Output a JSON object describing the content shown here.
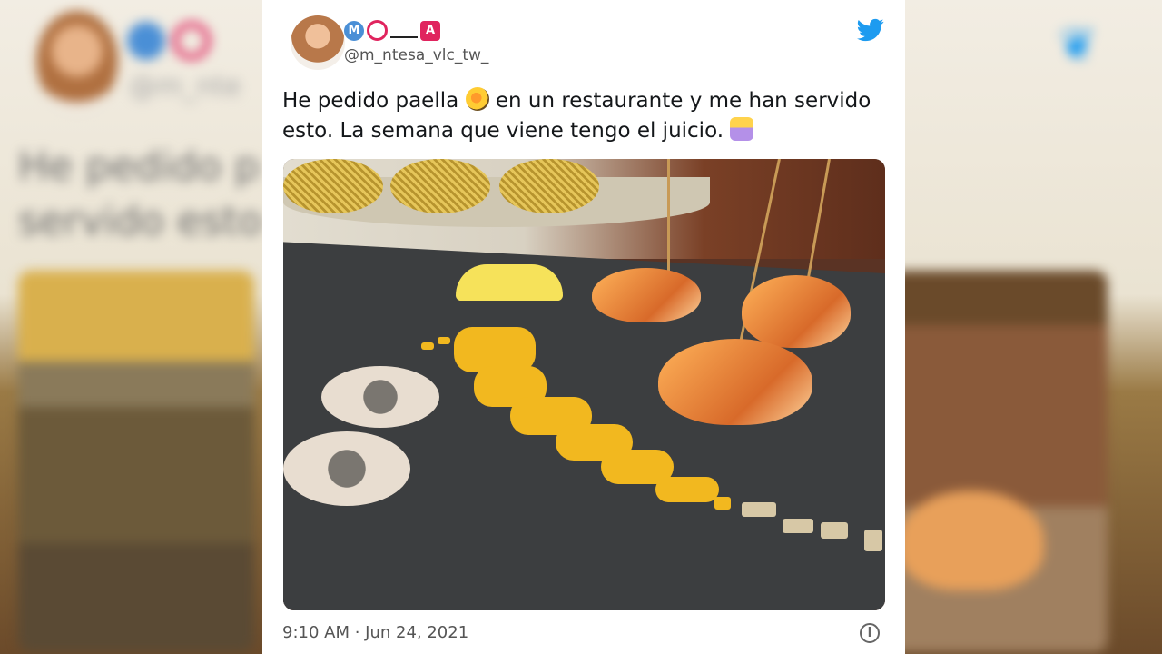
{
  "tweet": {
    "display_name_badges": [
      "M",
      "O",
      "A"
    ],
    "handle": "@m_ntesa_vlc_tw_",
    "text_part1": "He pedido paella ",
    "text_part2": " en un restaurante y me han servido esto. La semana que viene tengo el juicio. ",
    "timestamp": "9:10 AM · Jun 24, 2021",
    "info_label": "i",
    "emojis": [
      "paella-emoji",
      "facepalm-emoji"
    ]
  },
  "background": {
    "text_line1": "He pedido p                                         han",
    "text_line2": "servido esto                                        uicio.",
    "handle_fragment": "@m_nte"
  },
  "colors": {
    "twitter_blue": "#1d9bf0",
    "badge_red": "#e0245e",
    "badge_blue": "#4a8fd6"
  }
}
